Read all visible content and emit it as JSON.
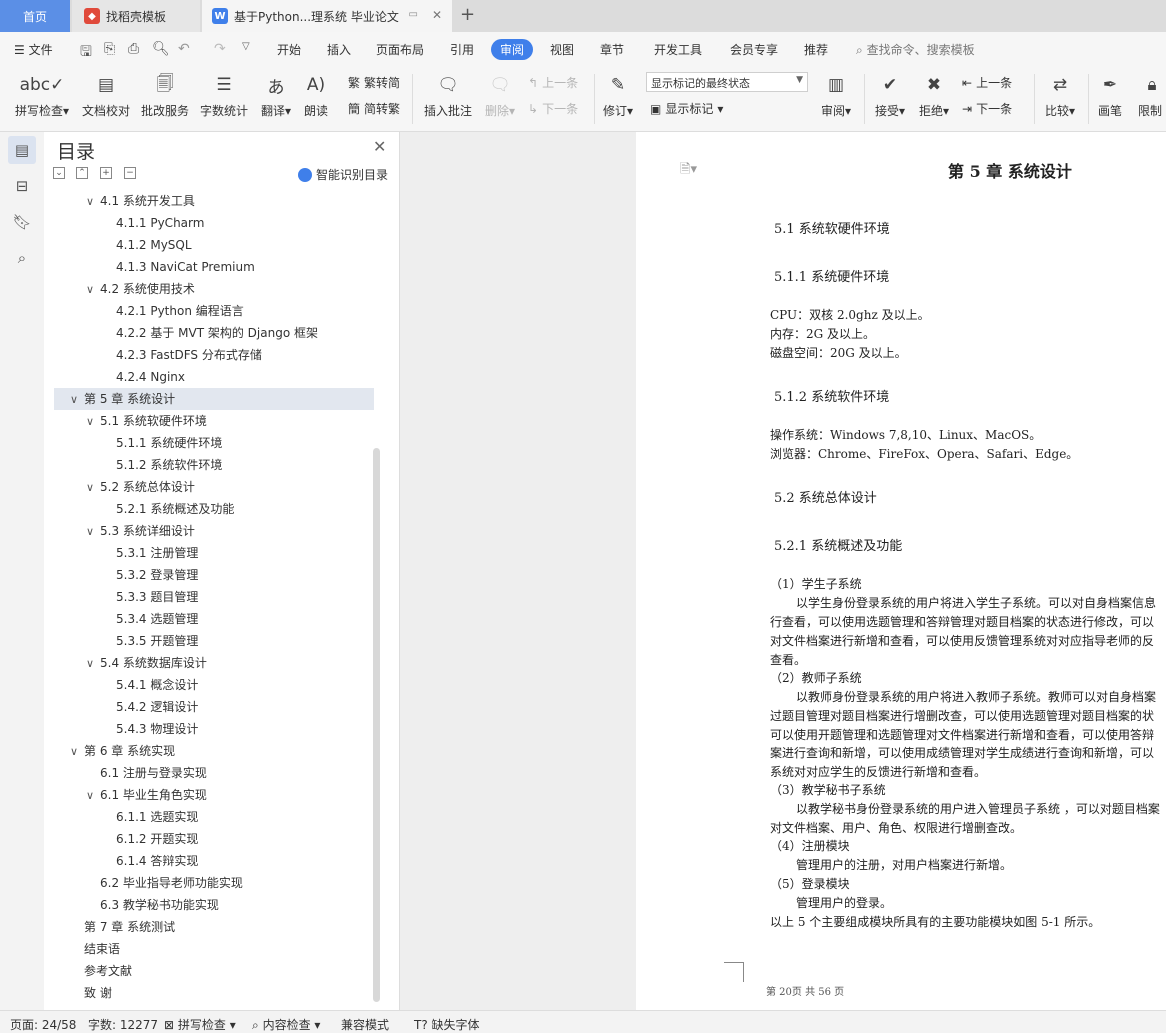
{
  "tabs": {
    "home": "首页",
    "template": "找稻壳模板",
    "document": "基于Python...理系统 毕业论文",
    "new": "+"
  },
  "menu": {
    "file": "文件",
    "items": [
      "开始",
      "插入",
      "页面布局",
      "引用",
      "审阅",
      "视图",
      "章节",
      "开发工具",
      "会员专享",
      "推荐"
    ],
    "search": "查找命令、搜索模板"
  },
  "ribbon": {
    "spell": "拼写检查",
    "proof": "文档校对",
    "batch": "批改服务",
    "count": "字数统计",
    "translate": "翻译",
    "read": "朗读",
    "trad": "繁转简",
    "simp": "简转繁",
    "add_comment": "插入批注",
    "delete": "删除",
    "prev": "上一条",
    "next": "下一条",
    "revise": "修订",
    "state": "显示标记的最终状态",
    "show_marks": "显示标记",
    "review": "审阅",
    "accept": "接受",
    "reject": "拒绝",
    "prev2": "上一条",
    "next2": "下一条",
    "compare": "比较",
    "pen": "画笔",
    "restrict": "限制"
  },
  "toc": {
    "title": "目录",
    "smart": "智能识别目录",
    "items": [
      {
        "t": "4.1  系统开发工具",
        "lv": 1,
        "car": "∨"
      },
      {
        "t": "4.1.1 PyCharm",
        "lv": 2
      },
      {
        "t": "4.1.2 MySQL",
        "lv": 2
      },
      {
        "t": "4.1.3 NaviCat Premium",
        "lv": 2
      },
      {
        "t": "4.2  系统使用技术",
        "lv": 1,
        "car": "∨"
      },
      {
        "t": "4.2.1 Python 编程语言",
        "lv": 2
      },
      {
        "t": "4.2.2 基于 MVT 架构的 Django 框架",
        "lv": 2
      },
      {
        "t": "4.2.3 FastDFS 分布式存储",
        "lv": 2
      },
      {
        "t": "4.2.4 Nginx",
        "lv": 2
      },
      {
        "t": "第 5 章  系统设计",
        "lv": 0,
        "car": "∨",
        "sel": true
      },
      {
        "t": "5.1 系统软硬件环境",
        "lv": 1,
        "car": "∨"
      },
      {
        "t": "5.1.1  系统硬件环境",
        "lv": 2
      },
      {
        "t": "5.1.2  系统软件环境",
        "lv": 2
      },
      {
        "t": "5.2 系统总体设计",
        "lv": 1,
        "car": "∨"
      },
      {
        "t": "5.2.1 系统概述及功能",
        "lv": 2
      },
      {
        "t": "5.3 系统详细设计",
        "lv": 1,
        "car": "∨"
      },
      {
        "t": "5.3.1  注册管理",
        "lv": 2
      },
      {
        "t": "5.3.2  登录管理",
        "lv": 2
      },
      {
        "t": "5.3.3  题目管理",
        "lv": 2
      },
      {
        "t": "5.3.4  选题管理",
        "lv": 2
      },
      {
        "t": "5.3.5  开题管理",
        "lv": 2
      },
      {
        "t": "5.4 系统数据库设计",
        "lv": 1,
        "car": "∨"
      },
      {
        "t": "5.4.1  概念设计",
        "lv": 2
      },
      {
        "t": "5.4.2  逻辑设计",
        "lv": 2
      },
      {
        "t": "5.4.3  物理设计",
        "lv": 2
      },
      {
        "t": "第 6 章  系统实现",
        "lv": 0,
        "car": "∨"
      },
      {
        "t": "6.1  注册与登录实现",
        "lv": 1
      },
      {
        "t": "6.1  毕业生角色实现",
        "lv": 1,
        "car": "∨"
      },
      {
        "t": "6.1.1 选题实现",
        "lv": 2
      },
      {
        "t": "6.1.2  开题实现",
        "lv": 2
      },
      {
        "t": "6.1.4  答辩实现",
        "lv": 2
      },
      {
        "t": "6.2  毕业指导老师功能实现",
        "lv": 1
      },
      {
        "t": "6.3  教学秘书功能实现",
        "lv": 1
      },
      {
        "t": "第 7 章  系统测试",
        "lv": 0
      },
      {
        "t": "结束语",
        "lv": 0
      },
      {
        "t": "参考文献",
        "lv": 0
      },
      {
        "t": "致  谢",
        "lv": 0
      }
    ]
  },
  "doc": {
    "chapter": "第 5 章  系统设计",
    "s51": "5.1 系统软硬件环境",
    "s511": "5.1.1  系统硬件环境",
    "cpu": "CPU：双核 2.0ghz 及以上。",
    "mem": "内存：2G 及以上。",
    "disk": "磁盘空间：20G 及以上。",
    "s512": "5.1.2  系统软件环境",
    "os": "操作系统：Windows 7,8,10、Linux、MacOS。",
    "browser": "浏览器：Chrome、FireFox、Opera、Safari、Edge。",
    "s52": "5.2 系统总体设计",
    "s521": "5.2.1 系统概述及功能",
    "p1": "（1）学生子系统",
    "p2": "以学生身份登录系统的用户将进入学生子系统。可以对自身档案信息",
    "p3": "行查看，可以使用选题管理和答辩管理对题目档案的状态进行修改，可以",
    "p4": "对文件档案进行新增和查看，可以使用反馈管理系统对对应指导老师的反",
    "p5": "查看。",
    "p6": "（2）教师子系统",
    "p7": "以教师身份登录系统的用户将进入教师子系统。教师可以对自身档案",
    "p8": "过题目管理对题目档案进行增删改查，可以使用选题管理对题目档案的状",
    "p9": "可以使用开题管理和选题管理对文件档案进行新增和查看，可以使用答辩",
    "p10": "案进行查询和新增，可以使用成绩管理对学生成绩进行查询和新增，可以",
    "p11": "系统对对应学生的反馈进行新增和查看。",
    "p12": "（3）教学秘书子系统",
    "p13": "以教学秘书身份登录系统的用户进入管理员子系统 ，可以对题目档案",
    "p14": "对文件档案、用户、角色、权限进行增删查改。",
    "p15": "（4）注册模块",
    "p16": "管理用户的注册，对用户档案进行新增。",
    "p17": "（5）登录模块",
    "p18": "管理用户的登录。",
    "p19": "以上 5 个主要组成模块所具有的主要功能模块如图 5-1 所示。",
    "footer": "第 20页  共 56 页"
  },
  "status": {
    "page": "页面: 24/58",
    "words": "字数: 12277",
    "spell": "拼写检查",
    "content": "内容检查",
    "compat": "兼容模式",
    "font": "缺失字体"
  },
  "colors": {
    "accent": "#3f7fea"
  }
}
